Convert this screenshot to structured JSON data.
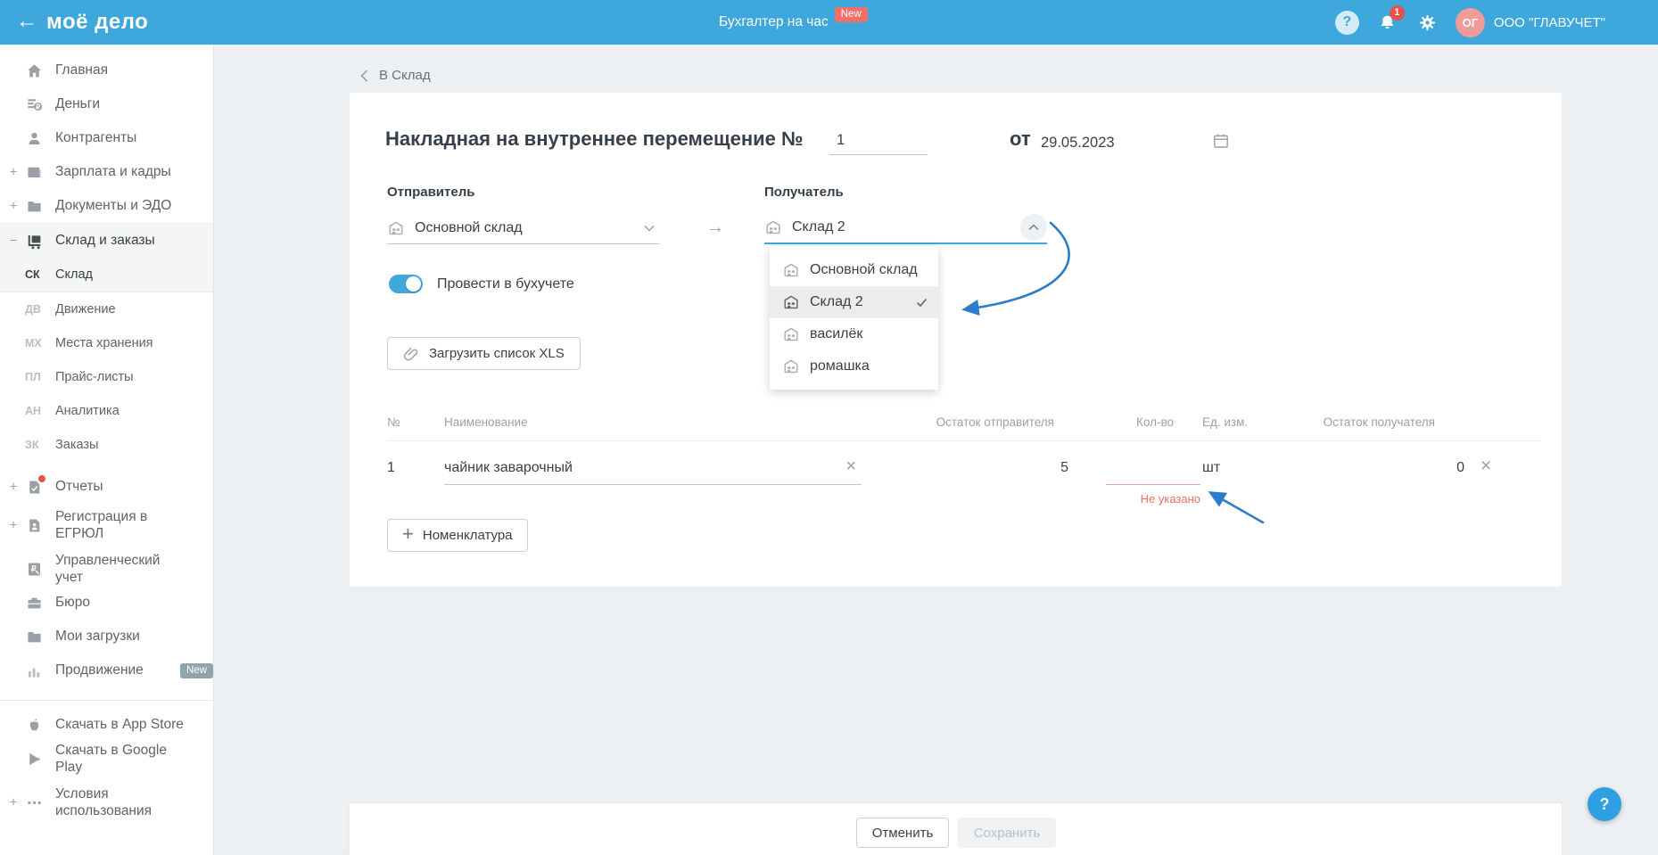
{
  "header": {
    "logo": "моё дело",
    "promo_label": "Бухгалтер на час",
    "promo_badge": "New",
    "notification_count": "1",
    "avatar_initials": "ОГ",
    "company_name": "ООО \"ГЛАВУЧЕТ\""
  },
  "sidebar": {
    "main_items": [
      {
        "label": "Главная"
      },
      {
        "label": "Деньги"
      },
      {
        "label": "Контрагенты"
      },
      {
        "label": "Зарплата и кадры",
        "expander": "+"
      },
      {
        "label": "Документы и ЭДО",
        "expander": "+"
      },
      {
        "label": "Склад и заказы",
        "expander": "−"
      }
    ],
    "warehouse_sub_items": [
      {
        "code": "СК",
        "label": "Склад"
      },
      {
        "code": "ДВ",
        "label": "Движение"
      },
      {
        "code": "МХ",
        "label": "Места хранения"
      },
      {
        "code": "ПЛ",
        "label": "Прайс-листы"
      },
      {
        "code": "АН",
        "label": "Аналитика"
      },
      {
        "code": "ЗК",
        "label": "Заказы"
      }
    ],
    "lower_items": [
      {
        "label": "Отчеты",
        "expander": "+"
      },
      {
        "label": "Регистрация в ЕГРЮЛ",
        "expander": "+"
      },
      {
        "label": "Управленческий учет"
      },
      {
        "label": "Бюро"
      },
      {
        "label": "Мои загрузки"
      },
      {
        "label": "Продвижение",
        "badge": "New"
      }
    ],
    "footer_items": [
      {
        "label": "Скачать в App Store"
      },
      {
        "label": "Скачать в Google Play"
      },
      {
        "label": "Условия использования",
        "expander": "+"
      }
    ]
  },
  "page": {
    "breadcrumb": "В Склад",
    "title": "Накладная на внутреннее перемещение №",
    "number_value": "1",
    "date_preposition": "от",
    "date_value": "29.05.2023"
  },
  "form": {
    "sender_label": "Отправитель",
    "sender_value": "Основной склад",
    "receiver_label": "Получатель",
    "receiver_value": "Склад 2",
    "toggle_label": "Провести в бухучете",
    "xls_button_label": "Загрузить список XLS",
    "nomenclature_button_label": "Номенклатура"
  },
  "receiver_dropdown": {
    "options": [
      {
        "label": "Основной склад",
        "selected": false
      },
      {
        "label": "Склад 2",
        "selected": true
      },
      {
        "label": "василёк",
        "selected": false
      },
      {
        "label": "ромашка",
        "selected": false
      }
    ]
  },
  "items_table": {
    "headers": [
      "№",
      "Наименование",
      "Остаток отправителя",
      "Кол-во",
      "Ед. изм.",
      "Остаток получателя"
    ],
    "rows": [
      {
        "num": "1",
        "name": "чайник заварочный",
        "sender_stock": "5",
        "quantity": "",
        "quantity_error": "Не указано",
        "unit": "шт",
        "receiver_stock": "0"
      }
    ]
  },
  "footer": {
    "cancel_label": "Отменить",
    "save_label": "Сохранить"
  },
  "colors": {
    "header_blue": "#3ea7dc",
    "accent_blue": "#3ea7dc",
    "error_red": "#ed6e62",
    "annotation_blue": "#2b7cc9",
    "badge_red": "#f07067"
  }
}
